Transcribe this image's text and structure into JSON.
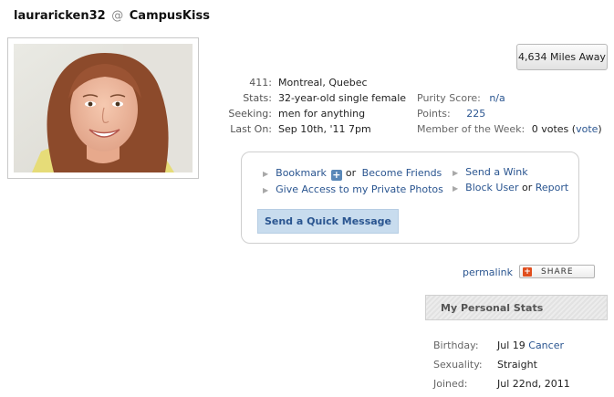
{
  "header": {
    "username": "lauraricken32",
    "at": "@",
    "site": "CampusKiss"
  },
  "distance_label": "4,634 Miles Away",
  "profile_info": [
    {
      "label": "411:",
      "value": "Montreal, Quebec"
    },
    {
      "label": "Stats:",
      "value": "32-year-old single female"
    },
    {
      "label": "Seeking:",
      "value": "men for anything"
    },
    {
      "label": "Last On:",
      "value": "Sep 10th, '11 7pm"
    }
  ],
  "scores": {
    "purity_label": "Purity Score:",
    "purity_value": "n/a",
    "points_label": "Points:",
    "points_value": "225",
    "motw_label": "Member of the Week:",
    "motw_votes": "0 votes",
    "motw_vote_link": "vote"
  },
  "actions": {
    "bookmark": "Bookmark",
    "or": "or",
    "become_friends": "Become Friends",
    "give_access": "Give Access to my Private Photos",
    "send_wink": "Send a Wink",
    "block_user": "Block User",
    "report": "Report",
    "quick_message": "Send a Quick Message"
  },
  "permalink": "permalink",
  "share_label": "SHARE",
  "personal_stats": {
    "title": "My Personal Stats",
    "birthday_label": "Birthday:",
    "birthday_value": "Jul 19",
    "birthday_sign": "Cancer",
    "sexuality_label": "Sexuality:",
    "sexuality_value": "Straight",
    "joined_label": "Joined:",
    "joined_value": "Jul 22nd, 2011"
  },
  "icons": {
    "bullet": "triangle-right-icon",
    "bookmark_plus": "plus-icon",
    "share": "share-plus-icon"
  },
  "colors": {
    "link": "#2a5590",
    "quick_message_bg": "#c8dcee",
    "share_icon": "#e04e1e"
  }
}
